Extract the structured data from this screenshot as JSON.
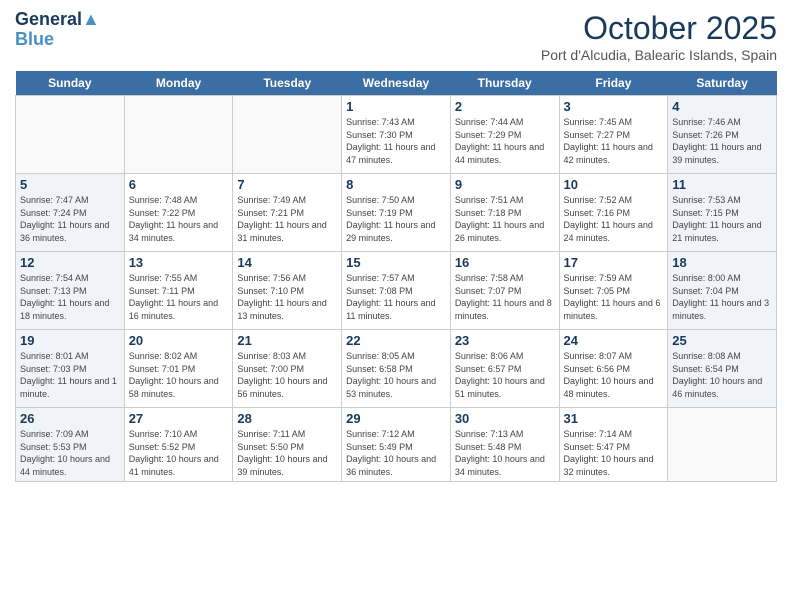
{
  "header": {
    "logo_line1": "General",
    "logo_line2": "Blue",
    "month": "October 2025",
    "location": "Port d'Alcudia, Balearic Islands, Spain"
  },
  "weekdays": [
    "Sunday",
    "Monday",
    "Tuesday",
    "Wednesday",
    "Thursday",
    "Friday",
    "Saturday"
  ],
  "weeks": [
    [
      {
        "day": "",
        "info": "",
        "type": "empty"
      },
      {
        "day": "",
        "info": "",
        "type": "empty"
      },
      {
        "day": "",
        "info": "",
        "type": "empty"
      },
      {
        "day": "1",
        "info": "Sunrise: 7:43 AM\nSunset: 7:30 PM\nDaylight: 11 hours and 47 minutes.",
        "type": "weekday"
      },
      {
        "day": "2",
        "info": "Sunrise: 7:44 AM\nSunset: 7:29 PM\nDaylight: 11 hours and 44 minutes.",
        "type": "weekday"
      },
      {
        "day": "3",
        "info": "Sunrise: 7:45 AM\nSunset: 7:27 PM\nDaylight: 11 hours and 42 minutes.",
        "type": "weekday"
      },
      {
        "day": "4",
        "info": "Sunrise: 7:46 AM\nSunset: 7:26 PM\nDaylight: 11 hours and 39 minutes.",
        "type": "weekend"
      }
    ],
    [
      {
        "day": "5",
        "info": "Sunrise: 7:47 AM\nSunset: 7:24 PM\nDaylight: 11 hours and 36 minutes.",
        "type": "weekend"
      },
      {
        "day": "6",
        "info": "Sunrise: 7:48 AM\nSunset: 7:22 PM\nDaylight: 11 hours and 34 minutes.",
        "type": "weekday"
      },
      {
        "day": "7",
        "info": "Sunrise: 7:49 AM\nSunset: 7:21 PM\nDaylight: 11 hours and 31 minutes.",
        "type": "weekday"
      },
      {
        "day": "8",
        "info": "Sunrise: 7:50 AM\nSunset: 7:19 PM\nDaylight: 11 hours and 29 minutes.",
        "type": "weekday"
      },
      {
        "day": "9",
        "info": "Sunrise: 7:51 AM\nSunset: 7:18 PM\nDaylight: 11 hours and 26 minutes.",
        "type": "weekday"
      },
      {
        "day": "10",
        "info": "Sunrise: 7:52 AM\nSunset: 7:16 PM\nDaylight: 11 hours and 24 minutes.",
        "type": "weekday"
      },
      {
        "day": "11",
        "info": "Sunrise: 7:53 AM\nSunset: 7:15 PM\nDaylight: 11 hours and 21 minutes.",
        "type": "weekend"
      }
    ],
    [
      {
        "day": "12",
        "info": "Sunrise: 7:54 AM\nSunset: 7:13 PM\nDaylight: 11 hours and 18 minutes.",
        "type": "weekend"
      },
      {
        "day": "13",
        "info": "Sunrise: 7:55 AM\nSunset: 7:11 PM\nDaylight: 11 hours and 16 minutes.",
        "type": "weekday"
      },
      {
        "day": "14",
        "info": "Sunrise: 7:56 AM\nSunset: 7:10 PM\nDaylight: 11 hours and 13 minutes.",
        "type": "weekday"
      },
      {
        "day": "15",
        "info": "Sunrise: 7:57 AM\nSunset: 7:08 PM\nDaylight: 11 hours and 11 minutes.",
        "type": "weekday"
      },
      {
        "day": "16",
        "info": "Sunrise: 7:58 AM\nSunset: 7:07 PM\nDaylight: 11 hours and 8 minutes.",
        "type": "weekday"
      },
      {
        "day": "17",
        "info": "Sunrise: 7:59 AM\nSunset: 7:05 PM\nDaylight: 11 hours and 6 minutes.",
        "type": "weekday"
      },
      {
        "day": "18",
        "info": "Sunrise: 8:00 AM\nSunset: 7:04 PM\nDaylight: 11 hours and 3 minutes.",
        "type": "weekend"
      }
    ],
    [
      {
        "day": "19",
        "info": "Sunrise: 8:01 AM\nSunset: 7:03 PM\nDaylight: 11 hours and 1 minute.",
        "type": "weekend"
      },
      {
        "day": "20",
        "info": "Sunrise: 8:02 AM\nSunset: 7:01 PM\nDaylight: 10 hours and 58 minutes.",
        "type": "weekday"
      },
      {
        "day": "21",
        "info": "Sunrise: 8:03 AM\nSunset: 7:00 PM\nDaylight: 10 hours and 56 minutes.",
        "type": "weekday"
      },
      {
        "day": "22",
        "info": "Sunrise: 8:05 AM\nSunset: 6:58 PM\nDaylight: 10 hours and 53 minutes.",
        "type": "weekday"
      },
      {
        "day": "23",
        "info": "Sunrise: 8:06 AM\nSunset: 6:57 PM\nDaylight: 10 hours and 51 minutes.",
        "type": "weekday"
      },
      {
        "day": "24",
        "info": "Sunrise: 8:07 AM\nSunset: 6:56 PM\nDaylight: 10 hours and 48 minutes.",
        "type": "weekday"
      },
      {
        "day": "25",
        "info": "Sunrise: 8:08 AM\nSunset: 6:54 PM\nDaylight: 10 hours and 46 minutes.",
        "type": "weekend"
      }
    ],
    [
      {
        "day": "26",
        "info": "Sunrise: 7:09 AM\nSunset: 5:53 PM\nDaylight: 10 hours and 44 minutes.",
        "type": "weekend"
      },
      {
        "day": "27",
        "info": "Sunrise: 7:10 AM\nSunset: 5:52 PM\nDaylight: 10 hours and 41 minutes.",
        "type": "weekday"
      },
      {
        "day": "28",
        "info": "Sunrise: 7:11 AM\nSunset: 5:50 PM\nDaylight: 10 hours and 39 minutes.",
        "type": "weekday"
      },
      {
        "day": "29",
        "info": "Sunrise: 7:12 AM\nSunset: 5:49 PM\nDaylight: 10 hours and 36 minutes.",
        "type": "weekday"
      },
      {
        "day": "30",
        "info": "Sunrise: 7:13 AM\nSunset: 5:48 PM\nDaylight: 10 hours and 34 minutes.",
        "type": "weekday"
      },
      {
        "day": "31",
        "info": "Sunrise: 7:14 AM\nSunset: 5:47 PM\nDaylight: 10 hours and 32 minutes.",
        "type": "weekday"
      },
      {
        "day": "",
        "info": "",
        "type": "empty"
      }
    ]
  ]
}
